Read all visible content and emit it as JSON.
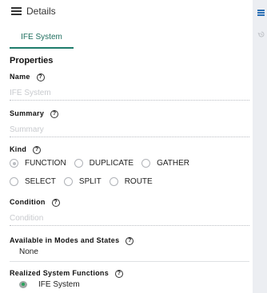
{
  "header": {
    "title": "Details"
  },
  "tabs": [
    {
      "label": "IFE System"
    }
  ],
  "properties": {
    "section_title": "Properties",
    "name": {
      "label": "Name",
      "placeholder": "IFE System",
      "value": ""
    },
    "summary": {
      "label": "Summary",
      "placeholder": "Summary",
      "value": ""
    },
    "kind": {
      "label": "Kind",
      "options": [
        "FUNCTION",
        "DUPLICATE",
        "GATHER",
        "SELECT",
        "SPLIT",
        "ROUTE"
      ],
      "selected": "FUNCTION"
    },
    "condition": {
      "label": "Condition",
      "placeholder": "Condition",
      "value": ""
    },
    "modes_states": {
      "label": "Available in Modes and States",
      "value": "None"
    },
    "realized": {
      "label": "Realized System Functions",
      "items": [
        "IFE System"
      ]
    }
  },
  "icons": {
    "header_menu": "hamburger-menu-icon",
    "help": "question-circle-icon",
    "strip_menu": "hamburger-menu-icon",
    "strip_history": "history-icon",
    "function": "system-function-icon"
  },
  "colors": {
    "accent": "#1e7c6b",
    "sidebar": "#eceef2",
    "strip_icon": "#2b6fb4"
  }
}
